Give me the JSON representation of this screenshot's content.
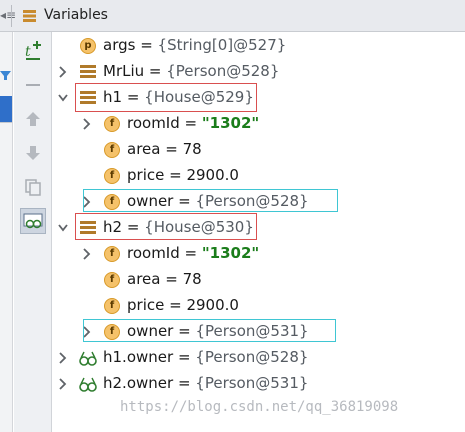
{
  "header": {
    "title": "Variables",
    "nav_arrows": "◂≡"
  },
  "tree": [
    {
      "name": "args",
      "eq": " = ",
      "value": "{String[0]@527}",
      "value_kind": "ref",
      "icon": "parameter-icon",
      "badge": "p",
      "expandable": false,
      "expanded": false,
      "indent": 0
    },
    {
      "name": "MrLiu",
      "eq": " = ",
      "value": "{Person@528}",
      "value_kind": "ref",
      "icon": "object-icon",
      "expandable": true,
      "expanded": false,
      "indent": 0
    },
    {
      "name": "h1",
      "eq": " = ",
      "value": "{House@529}",
      "value_kind": "ref",
      "icon": "object-icon",
      "expandable": true,
      "expanded": true,
      "indent": 0
    },
    {
      "name": "roomId",
      "eq": " = ",
      "value": "\"1302\"",
      "value_kind": "str",
      "icon": "field-icon",
      "badge": "f",
      "expandable": true,
      "expanded": false,
      "indent": 1
    },
    {
      "name": "area",
      "eq": " = ",
      "value": "78",
      "value_kind": "num",
      "icon": "field-icon",
      "badge": "f",
      "expandable": false,
      "expanded": false,
      "indent": 1
    },
    {
      "name": "price",
      "eq": " = ",
      "value": "2900.0",
      "value_kind": "num",
      "icon": "field-icon",
      "badge": "f",
      "expandable": false,
      "expanded": false,
      "indent": 1
    },
    {
      "name": "owner",
      "eq": " = ",
      "value": "{Person@528}",
      "value_kind": "ref",
      "icon": "field-icon",
      "badge": "f",
      "expandable": true,
      "expanded": false,
      "indent": 1
    },
    {
      "name": "h2",
      "eq": " = ",
      "value": "{House@530}",
      "value_kind": "ref",
      "icon": "object-icon",
      "expandable": true,
      "expanded": true,
      "indent": 0
    },
    {
      "name": "roomId",
      "eq": " = ",
      "value": "\"1302\"",
      "value_kind": "str",
      "icon": "field-icon",
      "badge": "f",
      "expandable": true,
      "expanded": false,
      "indent": 1
    },
    {
      "name": "area",
      "eq": " = ",
      "value": "78",
      "value_kind": "num",
      "icon": "field-icon",
      "badge": "f",
      "expandable": false,
      "expanded": false,
      "indent": 1
    },
    {
      "name": "price",
      "eq": " = ",
      "value": "2900.0",
      "value_kind": "num",
      "icon": "field-icon",
      "badge": "f",
      "expandable": false,
      "expanded": false,
      "indent": 1
    },
    {
      "name": "owner",
      "eq": " = ",
      "value": "{Person@531}",
      "value_kind": "ref",
      "icon": "field-icon",
      "badge": "f",
      "expandable": true,
      "expanded": false,
      "indent": 1
    },
    {
      "name": "h1.owner",
      "eq": " = ",
      "value": "{Person@528}",
      "value_kind": "ref",
      "icon": "watch-icon",
      "expandable": true,
      "expanded": false,
      "indent": 0
    },
    {
      "name": "h2.owner",
      "eq": " = ",
      "value": "{Person@531}",
      "value_kind": "ref",
      "icon": "watch-icon",
      "expandable": true,
      "expanded": false,
      "indent": 0
    }
  ],
  "toolbar_icons": [
    "new-watch-icon",
    "remove-watch-icon",
    "move-up-icon",
    "move-down-icon",
    "copy-icon",
    "show-watches-icon"
  ],
  "watermark": "https://blog.csdn.net/qq_36819098",
  "colors": {
    "string_value": "#1b7d1b",
    "ref_value": "#555b62",
    "highlight_red": "#d94f4f",
    "highlight_cyan": "#3fc6d3"
  }
}
